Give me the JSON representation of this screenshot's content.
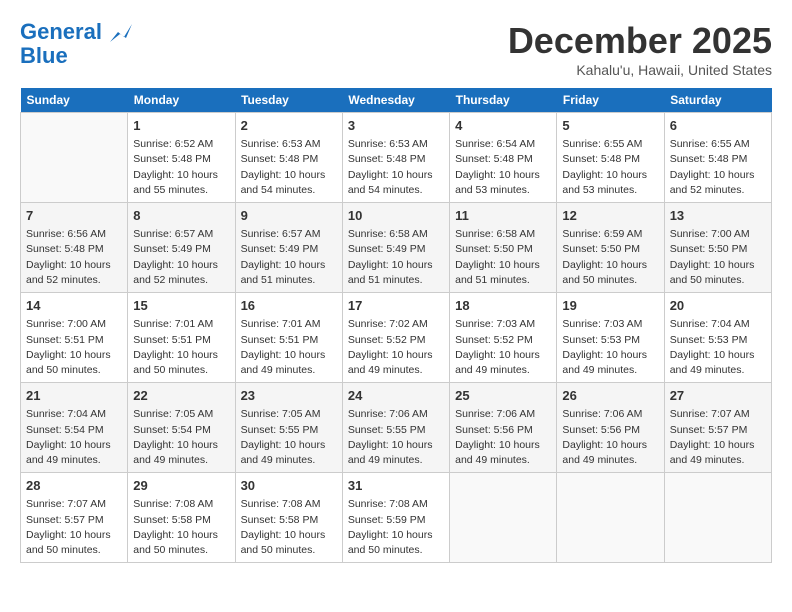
{
  "header": {
    "logo_line1": "General",
    "logo_line2": "Blue",
    "month_title": "December 2025",
    "location": "Kahalu'u, Hawaii, United States"
  },
  "days_of_week": [
    "Sunday",
    "Monday",
    "Tuesday",
    "Wednesday",
    "Thursday",
    "Friday",
    "Saturday"
  ],
  "weeks": [
    [
      {
        "num": "",
        "info": ""
      },
      {
        "num": "1",
        "info": "Sunrise: 6:52 AM\nSunset: 5:48 PM\nDaylight: 10 hours\nand 55 minutes."
      },
      {
        "num": "2",
        "info": "Sunrise: 6:53 AM\nSunset: 5:48 PM\nDaylight: 10 hours\nand 54 minutes."
      },
      {
        "num": "3",
        "info": "Sunrise: 6:53 AM\nSunset: 5:48 PM\nDaylight: 10 hours\nand 54 minutes."
      },
      {
        "num": "4",
        "info": "Sunrise: 6:54 AM\nSunset: 5:48 PM\nDaylight: 10 hours\nand 53 minutes."
      },
      {
        "num": "5",
        "info": "Sunrise: 6:55 AM\nSunset: 5:48 PM\nDaylight: 10 hours\nand 53 minutes."
      },
      {
        "num": "6",
        "info": "Sunrise: 6:55 AM\nSunset: 5:48 PM\nDaylight: 10 hours\nand 52 minutes."
      }
    ],
    [
      {
        "num": "7",
        "info": "Sunrise: 6:56 AM\nSunset: 5:48 PM\nDaylight: 10 hours\nand 52 minutes."
      },
      {
        "num": "8",
        "info": "Sunrise: 6:57 AM\nSunset: 5:49 PM\nDaylight: 10 hours\nand 52 minutes."
      },
      {
        "num": "9",
        "info": "Sunrise: 6:57 AM\nSunset: 5:49 PM\nDaylight: 10 hours\nand 51 minutes."
      },
      {
        "num": "10",
        "info": "Sunrise: 6:58 AM\nSunset: 5:49 PM\nDaylight: 10 hours\nand 51 minutes."
      },
      {
        "num": "11",
        "info": "Sunrise: 6:58 AM\nSunset: 5:50 PM\nDaylight: 10 hours\nand 51 minutes."
      },
      {
        "num": "12",
        "info": "Sunrise: 6:59 AM\nSunset: 5:50 PM\nDaylight: 10 hours\nand 50 minutes."
      },
      {
        "num": "13",
        "info": "Sunrise: 7:00 AM\nSunset: 5:50 PM\nDaylight: 10 hours\nand 50 minutes."
      }
    ],
    [
      {
        "num": "14",
        "info": "Sunrise: 7:00 AM\nSunset: 5:51 PM\nDaylight: 10 hours\nand 50 minutes."
      },
      {
        "num": "15",
        "info": "Sunrise: 7:01 AM\nSunset: 5:51 PM\nDaylight: 10 hours\nand 50 minutes."
      },
      {
        "num": "16",
        "info": "Sunrise: 7:01 AM\nSunset: 5:51 PM\nDaylight: 10 hours\nand 49 minutes."
      },
      {
        "num": "17",
        "info": "Sunrise: 7:02 AM\nSunset: 5:52 PM\nDaylight: 10 hours\nand 49 minutes."
      },
      {
        "num": "18",
        "info": "Sunrise: 7:03 AM\nSunset: 5:52 PM\nDaylight: 10 hours\nand 49 minutes."
      },
      {
        "num": "19",
        "info": "Sunrise: 7:03 AM\nSunset: 5:53 PM\nDaylight: 10 hours\nand 49 minutes."
      },
      {
        "num": "20",
        "info": "Sunrise: 7:04 AM\nSunset: 5:53 PM\nDaylight: 10 hours\nand 49 minutes."
      }
    ],
    [
      {
        "num": "21",
        "info": "Sunrise: 7:04 AM\nSunset: 5:54 PM\nDaylight: 10 hours\nand 49 minutes."
      },
      {
        "num": "22",
        "info": "Sunrise: 7:05 AM\nSunset: 5:54 PM\nDaylight: 10 hours\nand 49 minutes."
      },
      {
        "num": "23",
        "info": "Sunrise: 7:05 AM\nSunset: 5:55 PM\nDaylight: 10 hours\nand 49 minutes."
      },
      {
        "num": "24",
        "info": "Sunrise: 7:06 AM\nSunset: 5:55 PM\nDaylight: 10 hours\nand 49 minutes."
      },
      {
        "num": "25",
        "info": "Sunrise: 7:06 AM\nSunset: 5:56 PM\nDaylight: 10 hours\nand 49 minutes."
      },
      {
        "num": "26",
        "info": "Sunrise: 7:06 AM\nSunset: 5:56 PM\nDaylight: 10 hours\nand 49 minutes."
      },
      {
        "num": "27",
        "info": "Sunrise: 7:07 AM\nSunset: 5:57 PM\nDaylight: 10 hours\nand 49 minutes."
      }
    ],
    [
      {
        "num": "28",
        "info": "Sunrise: 7:07 AM\nSunset: 5:57 PM\nDaylight: 10 hours\nand 50 minutes."
      },
      {
        "num": "29",
        "info": "Sunrise: 7:08 AM\nSunset: 5:58 PM\nDaylight: 10 hours\nand 50 minutes."
      },
      {
        "num": "30",
        "info": "Sunrise: 7:08 AM\nSunset: 5:58 PM\nDaylight: 10 hours\nand 50 minutes."
      },
      {
        "num": "31",
        "info": "Sunrise: 7:08 AM\nSunset: 5:59 PM\nDaylight: 10 hours\nand 50 minutes."
      },
      {
        "num": "",
        "info": ""
      },
      {
        "num": "",
        "info": ""
      },
      {
        "num": "",
        "info": ""
      }
    ]
  ]
}
